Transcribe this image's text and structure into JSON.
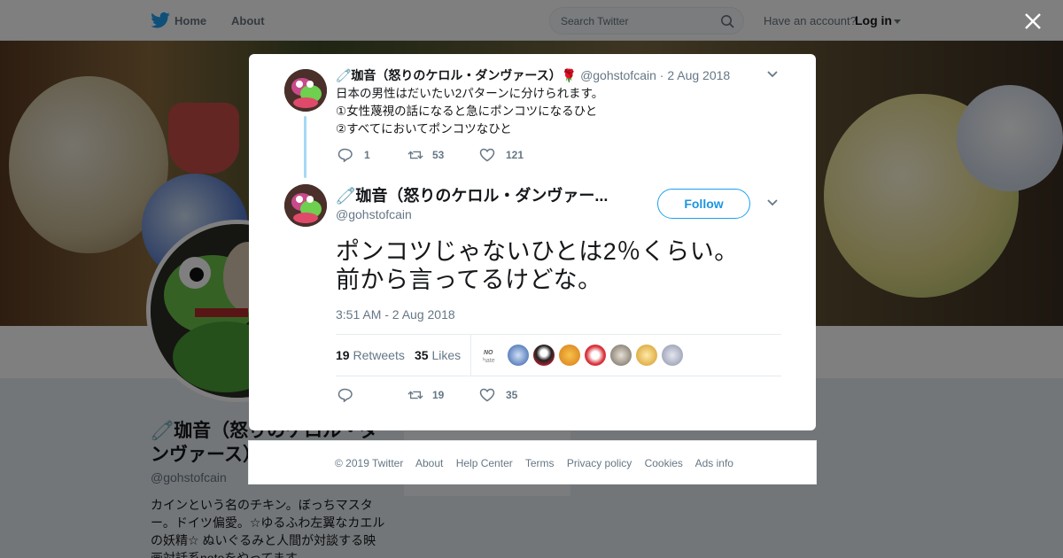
{
  "topbar": {
    "home_label": "Home",
    "about_label": "About",
    "search_placeholder": "Search Twitter",
    "have_account": "Have an account?",
    "login_label": "Log in"
  },
  "profile": {
    "name": "🧷珈音（怒りのケロル・ダンヴァース）",
    "handle": "@gohstofcain",
    "bio": "カインという名のチキン。ぼっちマスター。ドイツ偏愛。☆ゆるふわ左翼なカエルの妖精☆ ぬいぐるみと人間が対談する映画対話系noteをやってます"
  },
  "parent_tweet": {
    "name": "🧷珈音（怒りのケロル・ダンヴァース）🌹",
    "handle": "@gohstofcain",
    "date": "· 2 Aug 2018",
    "lines": [
      "日本の男性はだいたい2パターンに分けられます。",
      "①女性蔑視の話になると急にポンコツになるひと",
      "②すべてにおいてポンコツなひと"
    ],
    "replies": "1",
    "retweets": "53",
    "likes": "121"
  },
  "main_tweet": {
    "name": "🧷珈音（怒りのケロル・ダンヴァー...",
    "handle": "@gohstofcain",
    "follow_label": "Follow",
    "text_lines": [
      "ポンコツじゃないひとは2％くらい。",
      "前から言ってるけどな。"
    ],
    "timestamp": "3:51 AM - 2 Aug 2018",
    "retweet_count": "19",
    "retweet_label": "Retweets",
    "like_count": "35",
    "like_label": "Likes",
    "action_retweets": "19",
    "action_likes": "35"
  },
  "footer": {
    "links": [
      "© 2019 Twitter",
      "About",
      "Help Center",
      "Terms",
      "Privacy policy",
      "Cookies",
      "Ads info"
    ]
  },
  "colors": {
    "accent": "#1da1f2",
    "text": "#14171a",
    "muted": "#657786"
  }
}
